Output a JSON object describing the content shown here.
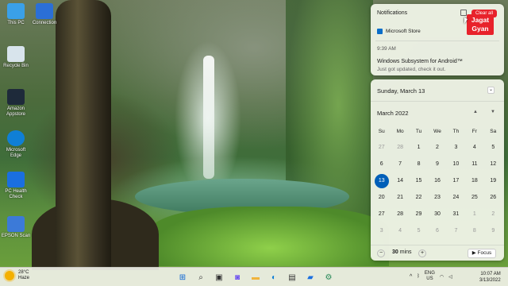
{
  "desktop": {
    "icons": [
      {
        "name": "this-pc",
        "label": "This PC",
        "color": "#3aa0e8"
      },
      {
        "name": "connection",
        "label": "Connection",
        "color": "#2b6fd6"
      },
      {
        "name": "recycle-bin",
        "label": "Recycle Bin",
        "color": "#d8e4ec"
      },
      {
        "name": "amazon",
        "label": "Amazon Appstore",
        "color": "#1e2a3a"
      },
      {
        "name": "edge",
        "label": "Microsoft Edge",
        "color": "#0f7fd6"
      },
      {
        "name": "pc-health",
        "label": "PC Health Check",
        "color": "#1a6fe0"
      },
      {
        "name": "epson",
        "label": "EPSON Scan",
        "color": "#3c7ad8"
      }
    ]
  },
  "notifications": {
    "title": "Notifications",
    "clear_all": "Clear all",
    "app_name": "Microsoft Store",
    "time": "9:39 AM",
    "heading": "Windows Subsystem for Android™",
    "body": "Just got updated, check it out."
  },
  "watermark": {
    "line1": "Jagat",
    "line2": "Gyan"
  },
  "calendar": {
    "date_heading": "Sunday, March 13",
    "month": "March 2022",
    "weekdays": [
      "Su",
      "Mo",
      "Tu",
      "We",
      "Th",
      "Fr",
      "Sa"
    ],
    "days": [
      [
        "27",
        "28",
        "1",
        "2",
        "3",
        "4",
        "5"
      ],
      [
        "6",
        "7",
        "8",
        "9",
        "10",
        "11",
        "12"
      ],
      [
        "13",
        "14",
        "15",
        "16",
        "17",
        "18",
        "19"
      ],
      [
        "20",
        "21",
        "22",
        "23",
        "24",
        "25",
        "26"
      ],
      [
        "27",
        "28",
        "29",
        "30",
        "31",
        "1",
        "2"
      ],
      [
        "3",
        "4",
        "5",
        "6",
        "7",
        "8",
        "9"
      ]
    ],
    "focus_minutes": "30",
    "focus_unit": "mins",
    "focus_label": "Focus"
  },
  "taskbar": {
    "temperature": "28°C",
    "condition": "Haze",
    "language": "ENG",
    "region": "US",
    "time": "10:07 AM",
    "date": "3/13/2022"
  }
}
